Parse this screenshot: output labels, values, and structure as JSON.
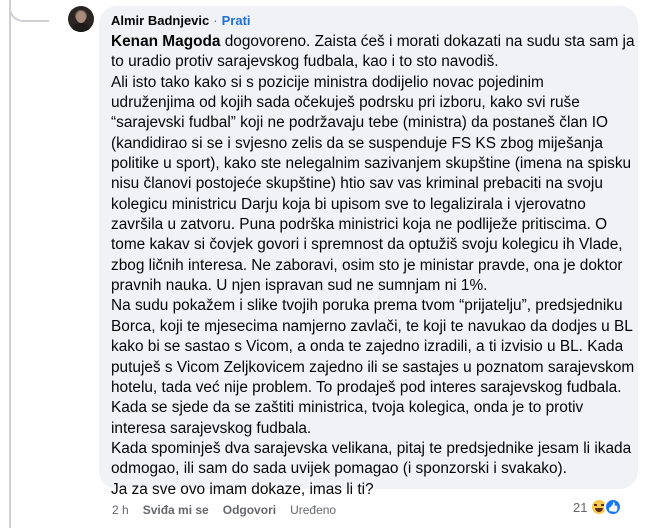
{
  "comment": {
    "author": "Almir Badnjevic",
    "separator": "·",
    "follow_label": "Prati",
    "mention": "Kenan Magoda",
    "first_line_rest": " dogovoreno. Zaista ćeš i morati dokazati na sudu sta sam ja",
    "lines": [
      "to uradio protiv sarajevskog fudbala, kao i to sto navodiš.",
      "Ali isto tako kako si s pozicije ministra dodijelio novac pojedinim",
      "udruženjima od kojih sada očekuješ podrsku pri izboru, kako svi ruše",
      "“sarajevski fudbal” koji ne podržavaju tebe (ministra) da postaneš član IO",
      "(kandidirao si se i svjesno zelis da se suspenduje FS KS zbog miješanja",
      "politike u sport), kako ste nelegalnim sazivanjem skupštine (imena na spisku",
      "nisu članovi postojeće skupštine) htio sav vas kriminal prebaciti na svoju",
      "kolegicu ministricu Darju koja bi upisom sve to legalizirala i vjerovatno",
      "završila u zatvoru. Puna podrška ministrici koja ne podliježe pritiscima. O",
      "tome kakav si čovjek govori i spremnost da optužiš svoju kolegicu ih Vlade,",
      "zbog ličnih interesa. Ne zaboravi, osim sto je ministar pravde, ona je doktor",
      "pravnih nauka. U njen ispravan sud ne sumnjam ni 1%.",
      "Na sudu pokažem i slike tvojih poruka prema tvom “prijatelju”, predsjedniku",
      "Borca, koji te mjesecima namjerno zavlači, te koji te navukao da dodjes u BL",
      "kako bi se sastao s Vicom, a onda te zajedno izradili, a ti izvisio u BL. Kada",
      "putuješ s Vicom Zeljkovicem zajedno ili se sastajes u poznatom sarajevskom",
      "hotelu, tada već nije problem. To prodaješ pod interes sarajevskog fudbala.",
      "Kada se sjede da se zaštiti ministrica, tvoja kolegica, onda je to protiv",
      "interesa sarajevskog fudbala.",
      "Kada spominješ dva sarajevska velikana, pitaj te predsjednike jesam li ikada",
      "odmogao, ili sam do sada uvijek pomagao (i sponzorski i svakako).",
      "Ja za sve ovo imam dokaze, imas li ti?"
    ]
  },
  "actions": {
    "time": "2 h",
    "like": "Sviđa mi se",
    "reply": "Odgovori",
    "edited": "Uređeno"
  },
  "reactions": {
    "count": "21",
    "icons": [
      "haha-icon",
      "like-icon"
    ]
  },
  "colors": {
    "bubble": "#f0f2f5",
    "link": "#216fdb",
    "muted": "#65676b",
    "text": "#050505"
  }
}
